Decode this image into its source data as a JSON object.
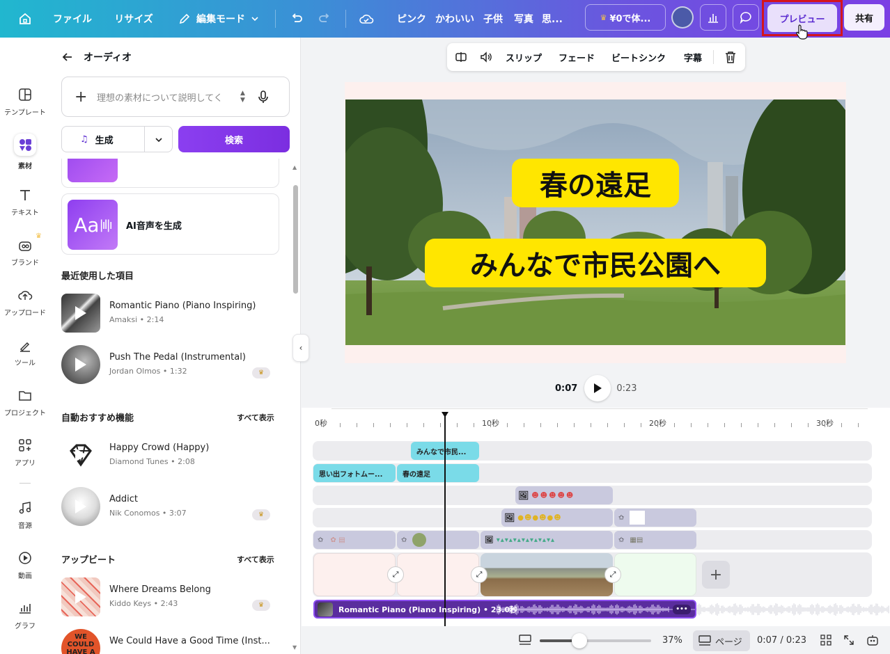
{
  "topbar": {
    "file": "ファイル",
    "resize": "リサイズ",
    "edit_mode": "編集モード",
    "tags": [
      "ピンク",
      "かわいい",
      "子供",
      "写真",
      "思..."
    ],
    "credit": "¥0で体...",
    "preview": "プレビュー",
    "share": "共有"
  },
  "rail": [
    {
      "label": "テンプレート",
      "icon": "template-icon"
    },
    {
      "label": "素材",
      "icon": "elements-icon"
    },
    {
      "label": "テキスト",
      "icon": "text-icon"
    },
    {
      "label": "ブランド",
      "icon": "brand-icon"
    },
    {
      "label": "アップロード",
      "icon": "upload-icon"
    },
    {
      "label": "ツール",
      "icon": "tools-icon"
    },
    {
      "label": "プロジェクト",
      "icon": "folder-icon"
    },
    {
      "label": "アプリ",
      "icon": "apps-icon"
    },
    {
      "label": "音源",
      "icon": "music-icon"
    },
    {
      "label": "動画",
      "icon": "video-icon"
    },
    {
      "label": "グラフ",
      "icon": "chart-icon"
    }
  ],
  "panel": {
    "title": "オーディオ",
    "search_placeholder": "理想の素材について説明してく",
    "generate": "生成",
    "search": "検索",
    "ai_voice": "AI音声を生成",
    "recent_heading": "最近使用した項目",
    "auto_heading": "自動おすすめ機能",
    "upbeat_heading": "アップビート",
    "show_all": "すべて表示",
    "recent": [
      {
        "title": "Romantic Piano (Piano Inspiring)",
        "sub": "Amaksi • 2:14",
        "premium": false
      },
      {
        "title": "Push The Pedal (Instrumental)",
        "sub": "Jordan Olmos • 1:32",
        "premium": true
      }
    ],
    "auto": [
      {
        "title": "Happy Crowd (Happy)",
        "sub": "Diamond Tunes • 2:08",
        "premium": false
      },
      {
        "title": "Addict",
        "sub": "Nik Conomos • 3:07",
        "premium": true
      }
    ],
    "upbeat": [
      {
        "title": "Where Dreams Belong",
        "sub": "Kiddo Keys • 2:43",
        "premium": true
      },
      {
        "title": "We Could Have a Good Time (Inst...",
        "sub": "",
        "premium": false
      }
    ]
  },
  "context_bar": {
    "slip": "スリップ",
    "fade": "フェード",
    "beat_sync": "ビートシンク",
    "captions": "字幕"
  },
  "canvas": {
    "caption1": "春の遠足",
    "caption2": "みんなで市民公園へ"
  },
  "player": {
    "current": "0:07",
    "total": "0:23"
  },
  "timeline": {
    "ruler": [
      "0秒",
      "10秒",
      "20秒",
      "30秒"
    ],
    "clips": {
      "text_top": "みんなで市民...",
      "text_a": "思い出フォトムー...",
      "text_b": "春の遠足"
    },
    "audio": "Romantic Piano (Piano Inspiring) • 23.0秒"
  },
  "bottom": {
    "zoom": "37%",
    "pages": "ページ",
    "time": "0:07 / 0:23"
  },
  "colors": {
    "accent": "#7d2ae8",
    "caption_bg": "#ffe600",
    "text_clip": "#7adbe8",
    "highlight": "#d4151c"
  }
}
